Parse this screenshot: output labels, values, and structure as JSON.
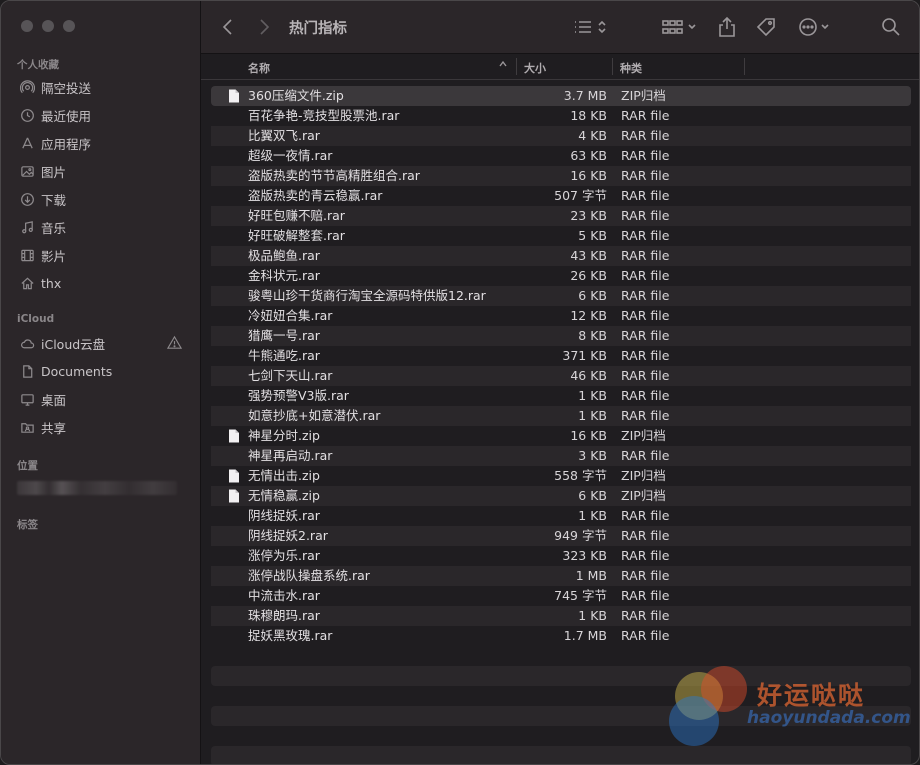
{
  "window": {
    "title": "热门指标"
  },
  "sidebar": {
    "favorites_header": "个人收藏",
    "favorites": [
      {
        "label": "隔空投送",
        "icon": "airdrop-icon"
      },
      {
        "label": "最近使用",
        "icon": "clock-icon"
      },
      {
        "label": "应用程序",
        "icon": "applications-icon"
      },
      {
        "label": "图片",
        "icon": "photo-icon"
      },
      {
        "label": "下载",
        "icon": "download-icon"
      },
      {
        "label": "音乐",
        "icon": "music-icon"
      },
      {
        "label": "影片",
        "icon": "film-icon"
      },
      {
        "label": "thx",
        "icon": "home-icon"
      }
    ],
    "icloud_header": "iCloud",
    "icloud": [
      {
        "label": "iCloud云盘",
        "icon": "cloud-icon"
      },
      {
        "label": "Documents",
        "icon": "document-icon"
      },
      {
        "label": "桌面",
        "icon": "desktop-icon"
      },
      {
        "label": "共享",
        "icon": "shared-folder-icon"
      }
    ],
    "locations_header": "位置",
    "tags_header": "标签"
  },
  "columns": {
    "name": "名称",
    "size": "大小",
    "kind": "种类"
  },
  "files": [
    {
      "name": "360压缩文件.zip",
      "size": "3.7 MB",
      "kind": "ZIP归档",
      "zip": true,
      "selected": true
    },
    {
      "name": "百花争艳-竞技型股票池.rar",
      "size": "18 KB",
      "kind": "RAR file"
    },
    {
      "name": "比翼双飞.rar",
      "size": "4 KB",
      "kind": "RAR file"
    },
    {
      "name": "超级一夜情.rar",
      "size": "63 KB",
      "kind": "RAR file"
    },
    {
      "name": "盗版热卖的节节高精胜组合.rar",
      "size": "16 KB",
      "kind": "RAR file"
    },
    {
      "name": "盗版热卖的青云稳赢.rar",
      "size": "507 字节",
      "kind": "RAR file"
    },
    {
      "name": "好旺包赚不赔.rar",
      "size": "23 KB",
      "kind": "RAR file"
    },
    {
      "name": "好旺破解整套.rar",
      "size": "5 KB",
      "kind": "RAR file"
    },
    {
      "name": "极品鲍鱼.rar",
      "size": "43 KB",
      "kind": "RAR file"
    },
    {
      "name": "金科状元.rar",
      "size": "26 KB",
      "kind": "RAR file"
    },
    {
      "name": "骏粤山珍干货商行淘宝全源码特供版12.rar",
      "size": "6 KB",
      "kind": "RAR file"
    },
    {
      "name": "冷妞妞合集.rar",
      "size": "12 KB",
      "kind": "RAR file"
    },
    {
      "name": "猎鹰一号.rar",
      "size": "8 KB",
      "kind": "RAR file"
    },
    {
      "name": "牛熊通吃.rar",
      "size": "371 KB",
      "kind": "RAR file"
    },
    {
      "name": "七剑下天山.rar",
      "size": "46 KB",
      "kind": "RAR file"
    },
    {
      "name": "强势预警V3版.rar",
      "size": "1 KB",
      "kind": "RAR file"
    },
    {
      "name": "如意抄底+如意潜伏.rar",
      "size": "1 KB",
      "kind": "RAR file"
    },
    {
      "name": "神星分时.zip",
      "size": "16 KB",
      "kind": "ZIP归档",
      "zip": true
    },
    {
      "name": "神星再启动.rar",
      "size": "3 KB",
      "kind": "RAR file"
    },
    {
      "name": "无情出击.zip",
      "size": "558 字节",
      "kind": "ZIP归档",
      "zip": true
    },
    {
      "name": "无情稳赢.zip",
      "size": "6 KB",
      "kind": "ZIP归档",
      "zip": true
    },
    {
      "name": "阴线捉妖.rar",
      "size": "1 KB",
      "kind": "RAR file"
    },
    {
      "name": "阴线捉妖2.rar",
      "size": "949 字节",
      "kind": "RAR file"
    },
    {
      "name": "涨停为乐.rar",
      "size": "323 KB",
      "kind": "RAR file"
    },
    {
      "name": "涨停战队操盘系统.rar",
      "size": "1 MB",
      "kind": "RAR file"
    },
    {
      "name": "中流击水.rar",
      "size": "745 字节",
      "kind": "RAR file"
    },
    {
      "name": "珠穆朗玛.rar",
      "size": "1 KB",
      "kind": "RAR file"
    },
    {
      "name": "捉妖黑玫瑰.rar",
      "size": "1.7 MB",
      "kind": "RAR file"
    }
  ],
  "watermark": {
    "text": "好运哒哒",
    "url_text": "haoyundada.com"
  }
}
